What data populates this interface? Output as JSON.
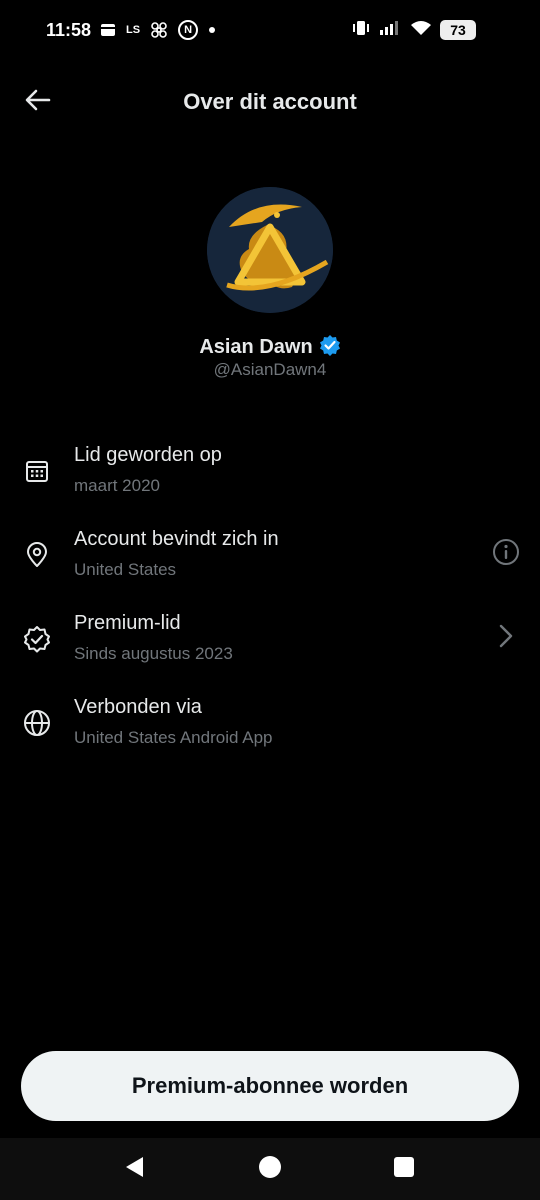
{
  "status_bar": {
    "time": "11:58",
    "battery": "73",
    "left_icons": [
      "card-icon",
      "ls-icon",
      "fan-icon",
      "n-icon",
      "dot-icon"
    ],
    "right_icons": [
      "vibrate-icon",
      "signal-icon",
      "wifi-icon",
      "battery-icon"
    ],
    "ls_text": "LS",
    "n_text": "N"
  },
  "header": {
    "title": "Over dit account",
    "back_icon": "arrow-left-icon"
  },
  "profile": {
    "name": "Asian Dawn",
    "handle": "@AsianDawn4",
    "verified": true,
    "verified_color": "#1d9bf0",
    "avatar_bg": "#16263b",
    "avatar_accent": "#e5a51f"
  },
  "info": [
    {
      "icon": "calendar-icon",
      "label": "Lid geworden op",
      "value": "maart 2020",
      "action": ""
    },
    {
      "icon": "location-pin-icon",
      "label": "Account bevindt zich in",
      "value": "United States",
      "action": "info-icon"
    },
    {
      "icon": "verified-badge-icon",
      "label": "Premium-lid",
      "value": "Sinds augustus 2023",
      "action": "chevron-right-icon"
    },
    {
      "icon": "globe-icon",
      "label": "Verbonden via",
      "value": "United States Android App",
      "action": ""
    }
  ],
  "cta": {
    "label": "Premium-abonnee worden"
  },
  "colors": {
    "background": "#000000",
    "primary_text": "#e7e9ea",
    "secondary_text": "#71767b",
    "button_bg": "#eff3f4",
    "button_text": "#0f1419"
  },
  "nav": [
    "back-triangle-icon",
    "home-circle-icon",
    "recents-square-icon"
  ]
}
